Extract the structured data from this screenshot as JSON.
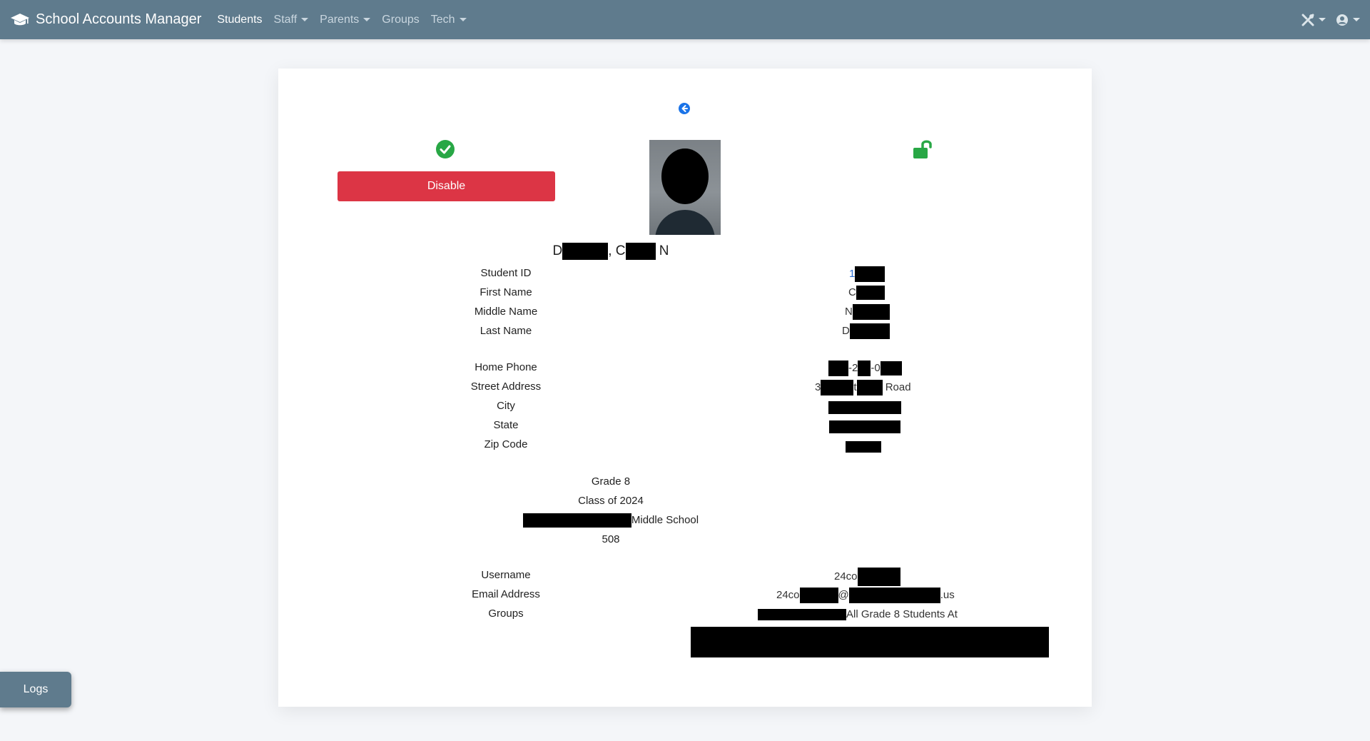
{
  "navbar": {
    "brand": "School Accounts Manager",
    "items": [
      {
        "label": "Students",
        "dropdown": false,
        "active": true
      },
      {
        "label": "Staff",
        "dropdown": true
      },
      {
        "label": "Parents",
        "dropdown": true
      },
      {
        "label": "Groups",
        "dropdown": false
      },
      {
        "label": "Tech",
        "dropdown": true
      }
    ],
    "right_icons": [
      "tools-icon",
      "user-circle-icon"
    ]
  },
  "student": {
    "status_icon": "check-circle-icon",
    "disable_label": "Disable",
    "lock_icon": "unlock-icon",
    "name_parts": {
      "first_initial": "D",
      "comma_initial": ", C",
      "middle": "N"
    },
    "fields": {
      "student_id_label": "Student ID",
      "first_name_label": "First Name",
      "middle_name_label": "Middle Name",
      "last_name_label": "Last Name",
      "home_phone_label": "Home Phone",
      "street_address_label": "Street Address",
      "city_label": "City",
      "state_label": "State",
      "zip_label": "Zip Code",
      "username_label": "Username",
      "email_label": "Email Address",
      "groups_label": "Groups"
    },
    "values": {
      "student_id_prefix": "1",
      "first_name_prefix": "C",
      "middle_name_prefix": "N",
      "last_name_prefix": "D",
      "phone_mid": "-2",
      "phone_mid2": "-0",
      "street_prefix": "3",
      "street_mid": "t",
      "street_suffix": "Road",
      "username_prefix": "24co",
      "email_prefix": "24co",
      "email_at": "@",
      "email_suffix": ".us",
      "groups_text": "All Grade 8 Students At"
    },
    "grade": "Grade 8",
    "class_of": "Class of 2024",
    "school_suffix": "Middle School",
    "room": "508"
  },
  "logs_label": "Logs"
}
